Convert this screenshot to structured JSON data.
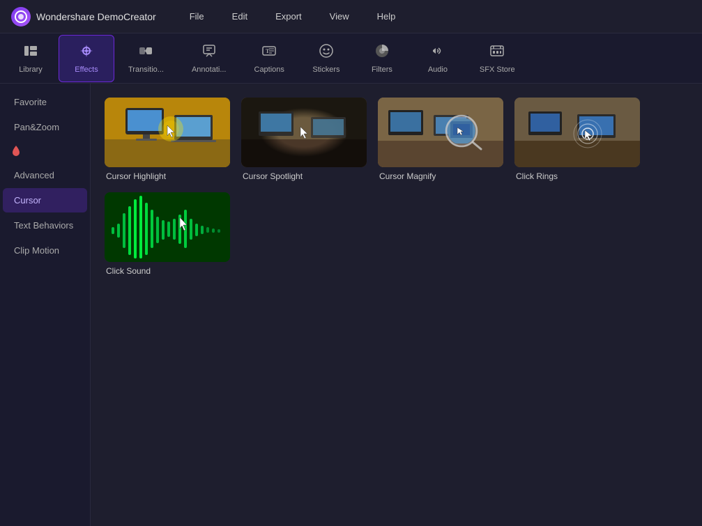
{
  "app": {
    "brand_icon": "C",
    "brand_name": "Wondershare DemoCreator"
  },
  "menu": {
    "items": [
      "File",
      "Edit",
      "Export",
      "View",
      "Help"
    ]
  },
  "toolbar": {
    "items": [
      {
        "id": "library",
        "label": "Library",
        "icon": "⊞"
      },
      {
        "id": "effects",
        "label": "Effects",
        "icon": "✦",
        "active": true
      },
      {
        "id": "transitions",
        "label": "Transitio...",
        "icon": "⏭"
      },
      {
        "id": "annotations",
        "label": "Annotati...",
        "icon": "💬"
      },
      {
        "id": "captions",
        "label": "Captions",
        "icon": "T"
      },
      {
        "id": "stickers",
        "label": "Stickers",
        "icon": "☺"
      },
      {
        "id": "filters",
        "label": "Filters",
        "icon": "◑"
      },
      {
        "id": "audio",
        "label": "Audio",
        "icon": "♪"
      },
      {
        "id": "sfxstore",
        "label": "SFX Store",
        "icon": "🗃"
      }
    ]
  },
  "sidebar": {
    "items": [
      {
        "id": "favorite",
        "label": "Favorite",
        "active": false
      },
      {
        "id": "panzoom",
        "label": "Pan&Zoom",
        "active": false
      },
      {
        "id": "advanced",
        "label": "Advanced",
        "active": false
      },
      {
        "id": "cursor",
        "label": "Cursor",
        "active": true
      },
      {
        "id": "textbehaviors",
        "label": "Text Behaviors",
        "active": false
      },
      {
        "id": "clipmotion",
        "label": "Clip Motion",
        "active": false
      }
    ]
  },
  "effects": {
    "items": [
      {
        "id": "cursor-highlight",
        "label": "Cursor Highlight",
        "thumb_type": "highlight"
      },
      {
        "id": "cursor-spotlight",
        "label": "Cursor Spotlight",
        "thumb_type": "spotlight"
      },
      {
        "id": "cursor-magnify",
        "label": "Cursor Magnify",
        "thumb_type": "magnify"
      },
      {
        "id": "click-rings",
        "label": "Click Rings",
        "thumb_type": "clickrings"
      },
      {
        "id": "click-sound",
        "label": "Click Sound",
        "thumb_type": "clicksound"
      }
    ]
  },
  "colors": {
    "active_bg": "#312060",
    "active_text": "#c4b5fd",
    "accent": "#7c3aed",
    "brand_gradient_start": "#7c3aed",
    "brand_gradient_end": "#a855f7"
  }
}
